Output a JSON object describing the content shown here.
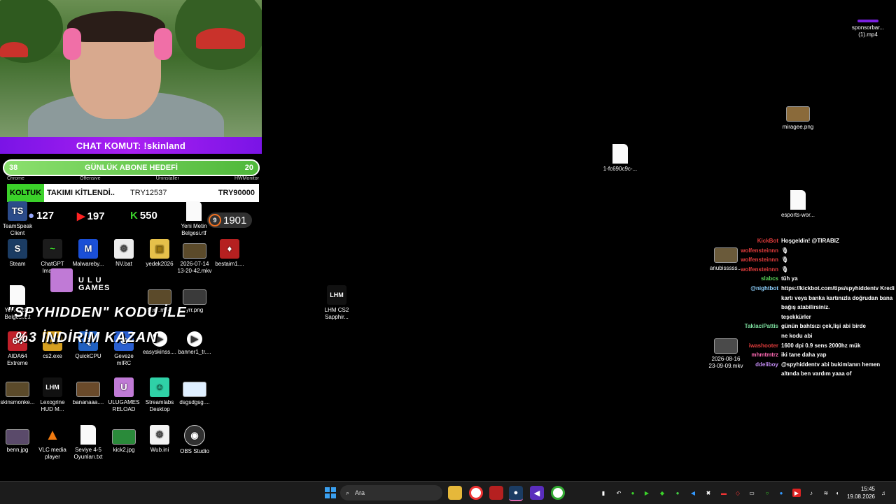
{
  "overlay": {
    "command_label": "CHAT KOMUT: !skinland",
    "goal_label": "GÜNLÜK ABONE HEDEFİ",
    "goal_current": "38",
    "goal_target": "20",
    "alert_tag": "KOLTUK",
    "alert_text": "TAKIMI KİTLENDİ..",
    "alert_price": "TRY12537",
    "alert_goal": "TRY90000",
    "stat_viewers": "127",
    "stat_youtube": "197",
    "stat_kick": "550",
    "stat_level": "9",
    "stat_points": "1901",
    "brand_name": "U L U\nGAMES",
    "promo_line1": "\"SPYHIDDEN\" KODU İLE",
    "promo_line2": "%3 İNDİRİM KAZAN"
  },
  "desktop": {
    "icons": [
      {
        "label": "TeamSpeak Client",
        "glyph": "TS",
        "color": "#2b4b8a"
      },
      {
        "label": "Steam",
        "glyph": "S",
        "color": "#1b3c63"
      },
      {
        "label": "ChatGPT Image...",
        "glyph": "~",
        "color": "#1c1c1c"
      },
      {
        "label": "Malwareby...",
        "glyph": "M",
        "color": "#1a4fd6"
      },
      {
        "label": "NV.bat",
        "glyph": "⚙",
        "color": "#ececec"
      },
      {
        "label": "yedek2026",
        "glyph": "▣",
        "color": "#e6c04a"
      },
      {
        "label": "2026-07-14 13-20-42.mkv",
        "glyph": "▶",
        "color": "#5a4a3a"
      },
      {
        "label": "bestaim1....",
        "glyph": "♦",
        "color": "#b52020"
      },
      {
        "label": "Yeni Metin Belgesi.txt",
        "glyph": "",
        "color": "#fafafa"
      },
      {
        "label": "ffertt.mp4",
        "glyph": "▶",
        "color": "#6a5034"
      },
      {
        "label": "yrr.png",
        "glyph": "",
        "color": "#3a3a3a"
      },
      {
        "label": "AIDA64 Extreme",
        "glyph": "64",
        "color": "#c0202a"
      },
      {
        "label": "cs2.exe",
        "glyph": "CS",
        "color": "#d6a020"
      },
      {
        "label": "QuickCPU",
        "glyph": "Q",
        "color": "#2060c0"
      },
      {
        "label": "Geveze mIRC",
        "glyph": "G",
        "color": "#2a5fd0"
      },
      {
        "label": "easyskinss....",
        "glyph": "▶",
        "color": "#ffffff"
      },
      {
        "label": "banner1_tr....",
        "glyph": "▶",
        "color": "#ffffff"
      },
      {
        "label": "skinsmonke...",
        "glyph": "",
        "color": "#4a3a2a"
      },
      {
        "label": "Lexogrine HUD M...",
        "glyph": "LHM",
        "color": "#111111"
      },
      {
        "label": "bananaaa....",
        "glyph": "",
        "color": "#6a4a2a"
      },
      {
        "label": "ULUGAMES RELOAD",
        "glyph": "U",
        "color": "#c07ad6"
      },
      {
        "label": "Streamlabs Desktop",
        "glyph": "☺",
        "color": "#2fd1a7"
      },
      {
        "label": "dsgsdgsg....",
        "glyph": "",
        "color": "#dfefff"
      },
      {
        "label": "benn.jpg",
        "glyph": "",
        "color": "#5a4a6a"
      },
      {
        "label": "VLC media player",
        "glyph": "▲",
        "color": "#f07a10"
      },
      {
        "label": "Seviye 4-5 Oyunları.txt",
        "glyph": "",
        "color": "#fafafa"
      },
      {
        "label": "kick2.jpg",
        "glyph": "",
        "color": "#2a8a3a"
      },
      {
        "label": "Wub.ini",
        "glyph": "⚙",
        "color": "#f2f2f2"
      },
      {
        "label": "OBS Studio",
        "glyph": "◉",
        "color": "#303030"
      },
      {
        "label": "Yeni Metin Belgesi.rtf",
        "glyph": "",
        "color": "#fafafa"
      },
      {
        "label": "LHM CS2 Sapphir...",
        "glyph": "LHM",
        "color": "#111111"
      },
      {
        "label": "1-fc690c9c-...",
        "glyph": "",
        "color": "#fafafa"
      },
      {
        "label": "sponsorbar... (1).mp4",
        "glyph": "",
        "color": "#7a20e0"
      },
      {
        "label": "miragee.png",
        "glyph": "",
        "color": "#8a6a3a"
      },
      {
        "label": "esports-wor...",
        "glyph": "",
        "color": "#fafafa"
      },
      {
        "label": "anubisssss...",
        "glyph": "",
        "color": "#6a5a3a"
      },
      {
        "label": "2026-08-16 23-09-09.mkv",
        "glyph": "",
        "color": "#4a4a4a"
      }
    ],
    "cut_labels": [
      "Chrome",
      "Offensive",
      "Uninstaller",
      "HWMonitor"
    ]
  },
  "chat": {
    "messages": [
      {
        "user": "KickBot",
        "color": "#e23c3c",
        "text": "Hoşgeldin! @TIRABIZ"
      },
      {
        "user": "wolfensteinnn",
        "color": "#e23c3c",
        "text": "🎙"
      },
      {
        "user": "wolfensteinnn",
        "color": "#e23c3c",
        "text": "🎙"
      },
      {
        "user": "wolfensteinnn",
        "color": "#e23c3c",
        "text": "🎙"
      },
      {
        "user": "slabcs",
        "color": "#5ad65a",
        "text": "tüh ya"
      },
      {
        "user": "@nightbot",
        "color": "#8ed1ff",
        "text": "https://kickbot.com/tips/spyhiddentv Kredi kartı veya banka kartınızla doğrudan bana bağış atabilirsiniz."
      },
      {
        "user": "",
        "color": "#3c6cf0",
        "text": "teşekkürler"
      },
      {
        "user": "TaklaciPattis",
        "color": "#7ee0a0",
        "text": "günün bahtsızı çek,lişi abi birde"
      },
      {
        "user": "",
        "color": "#3c6cf0",
        "text": "ne kodu abi"
      },
      {
        "user": "iwashooter",
        "color": "#e23c3c",
        "text": "1600 dpi 0.9 sens 2000hz mük"
      },
      {
        "user": "mhmtmtrz",
        "color": "#ff69b4",
        "text": "iki tane daha yap"
      },
      {
        "user": "ddeliboy",
        "color": "#c08af0",
        "text": "@spyhiddentv abi bukimlanın hemen altında ben vardım yaaa of"
      }
    ]
  },
  "taskbar": {
    "search_placeholder": "Ara",
    "time": "15:45",
    "date": "19.08.2026",
    "start_icon": "windows-start-icon",
    "apps": [
      "file-explorer-icon",
      "chrome-icon",
      "voicemeeter-icon",
      "steam-icon",
      "visual-studio-icon",
      "chrome-profile-icon"
    ]
  }
}
